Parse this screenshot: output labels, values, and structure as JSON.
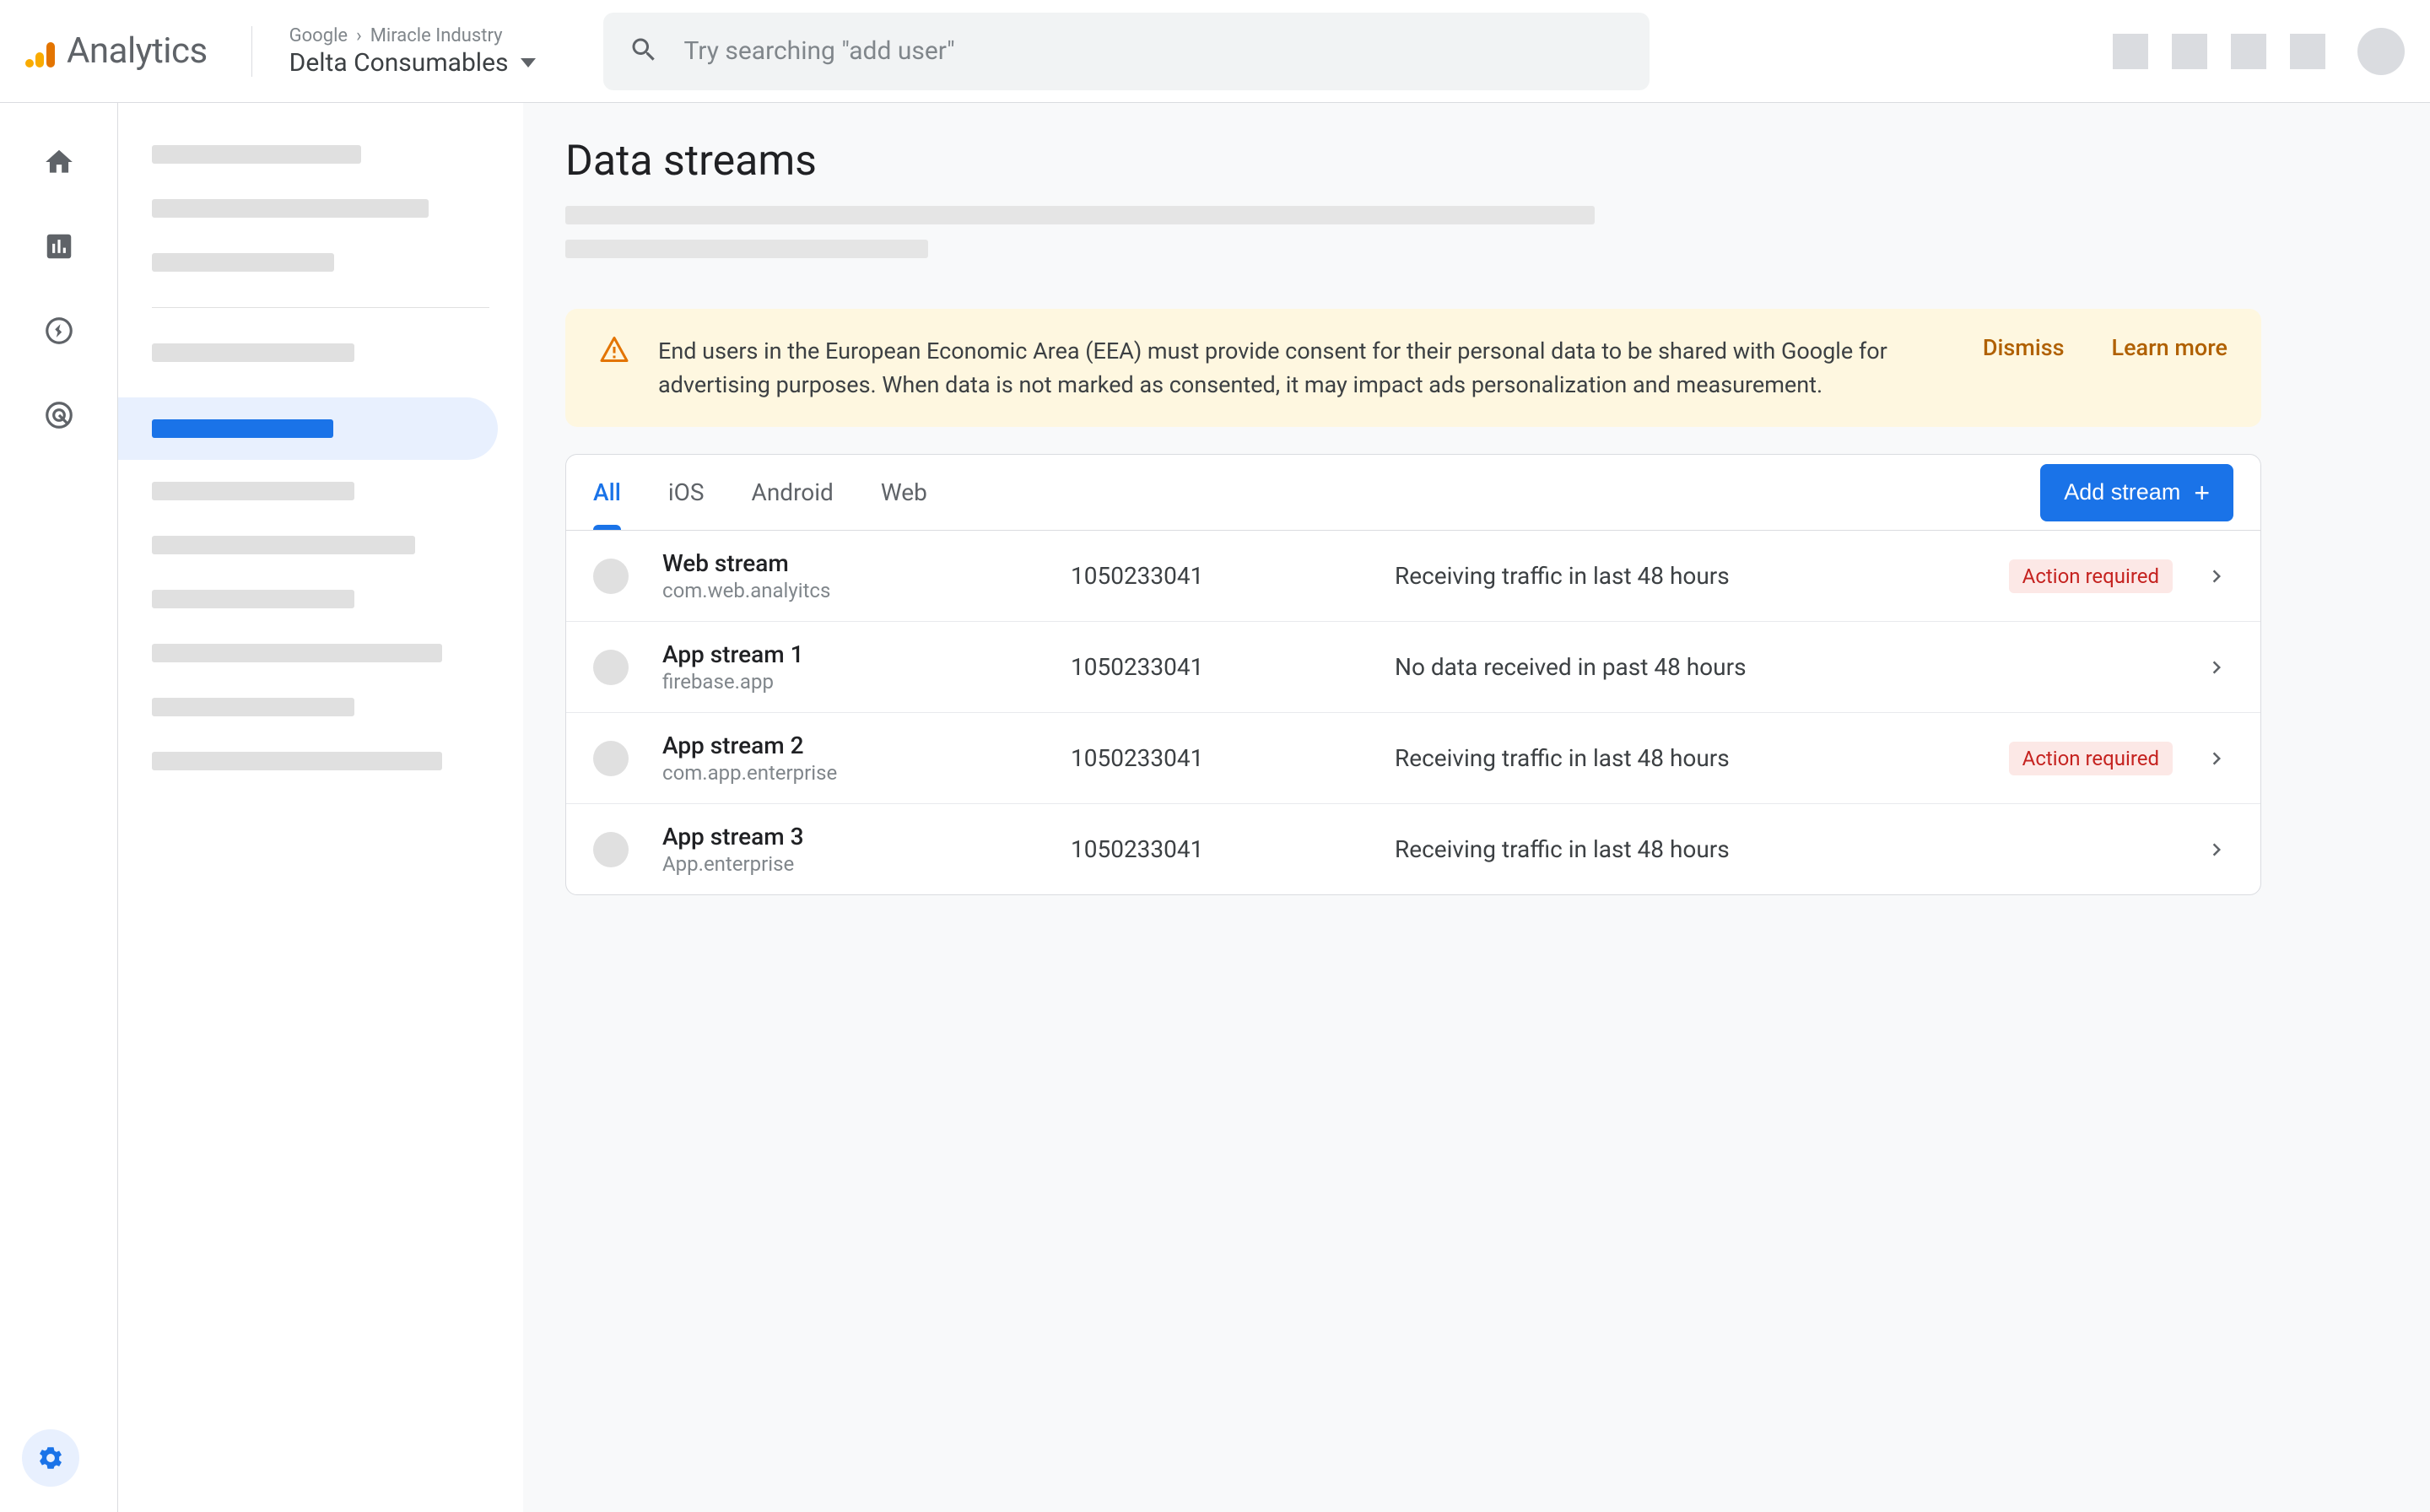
{
  "header": {
    "product": "Analytics",
    "breadcrumb_org": "Google",
    "breadcrumb_account": "Miracle Industry",
    "property": "Delta Consumables",
    "search_placeholder": "Try searching \"add user\""
  },
  "page": {
    "title": "Data streams"
  },
  "alert": {
    "message": "End users in the European Economic Area (EEA) must provide consent for their personal data to be shared with Google for advertising purposes. When data is not marked as consented, it may impact ads personalization and measurement.",
    "dismiss": "Dismiss",
    "learn_more": "Learn more"
  },
  "tabs": {
    "all": "All",
    "ios": "iOS",
    "android": "Android",
    "web": "Web"
  },
  "add_stream_label": "Add stream",
  "action_required_label": "Action required",
  "streams": [
    {
      "name": "Web stream",
      "sub": "com.web.analyitcs",
      "id": "1050233041",
      "status": "Receiving traffic in last 48 hours",
      "action_required": true
    },
    {
      "name": "App stream 1",
      "sub": "firebase.app",
      "id": "1050233041",
      "status": "No data received in past 48 hours",
      "action_required": false
    },
    {
      "name": "App stream 2",
      "sub": "com.app.enterprise",
      "id": "1050233041",
      "status": "Receiving traffic in last 48 hours",
      "action_required": true
    },
    {
      "name": "App stream 3",
      "sub": "App.enterprise",
      "id": "1050233041",
      "status": "Receiving traffic in last 48 hours",
      "action_required": false
    }
  ]
}
